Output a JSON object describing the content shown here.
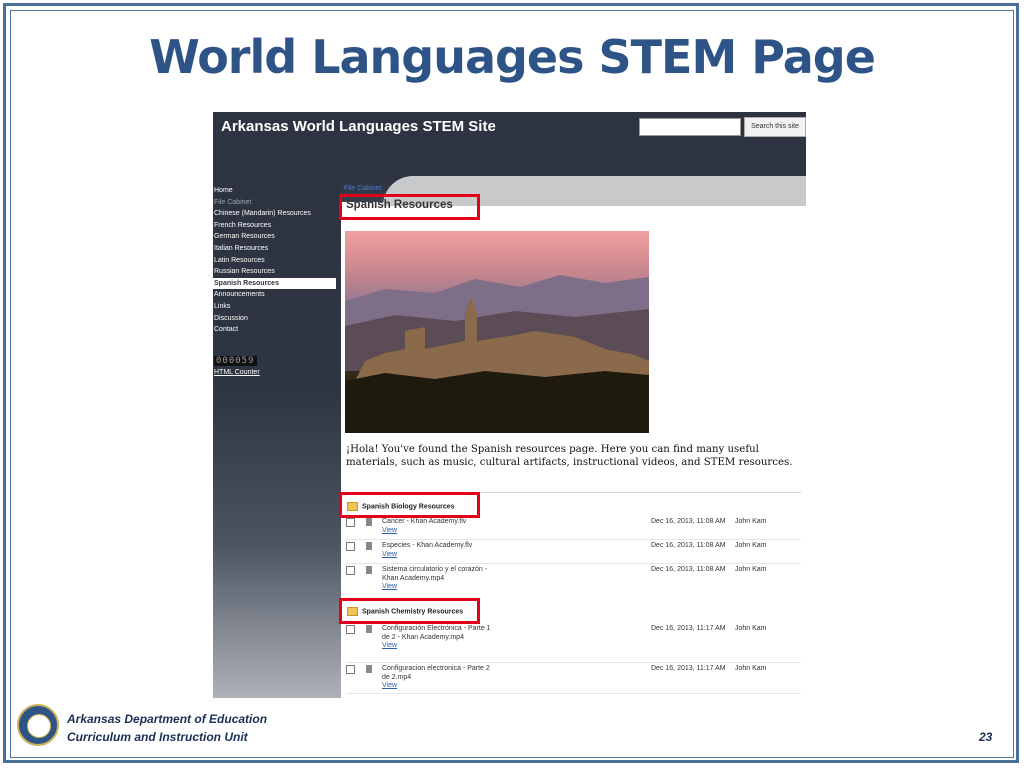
{
  "slide": {
    "title": "World Languages STEM Page",
    "footer_line1": "Arkansas Department of Education",
    "footer_line2": "Curriculum and Instruction Unit",
    "page_number": "23"
  },
  "site": {
    "title": "Arkansas World Languages STEM Site",
    "search_placeholder": "",
    "search_button": "Search this site"
  },
  "sidebar": {
    "items": [
      {
        "label": "Home"
      },
      {
        "label": "File Cabinet"
      },
      {
        "label": "Chinese (Mandarin) Resources"
      },
      {
        "label": "French Resources"
      },
      {
        "label": "German Resources"
      },
      {
        "label": "Italian Resources"
      },
      {
        "label": "Latin Resources"
      },
      {
        "label": "Russian Resources"
      },
      {
        "label": "Spanish Resources"
      },
      {
        "label": "Announcements"
      },
      {
        "label": "Links"
      },
      {
        "label": "Discussion"
      },
      {
        "label": "Contact"
      }
    ],
    "active_item": "Spanish Resources",
    "counter_value": "000059",
    "counter_link": "HTML Counter"
  },
  "main": {
    "breadcrumb": "File Cabinet",
    "heading": "Spanish Resources",
    "intro": "¡Hola!  You've found the Spanish resources page.  Here you can find many useful materials, such as music, cultural artifacts, instructional videos, and STEM resources.",
    "folders": [
      {
        "name": "Spanish Biology Resources",
        "files": [
          {
            "name": "Cancer - Khan Academy.flv",
            "view": "View",
            "date": "Dec 16, 2013, 11:08 AM",
            "author": "John Kam"
          },
          {
            "name": "Especies - Khan Academy.flv",
            "view": "View",
            "date": "Dec 16, 2013, 11:08 AM",
            "author": "John Kam"
          },
          {
            "name": "Sistema circulatorio y el corazón - Khan Academy.mp4",
            "view": "View",
            "date": "Dec 16, 2013, 11:08 AM",
            "author": "John Kam"
          }
        ]
      },
      {
        "name": "Spanish Chemistry Resources",
        "files": [
          {
            "name": "Configuración Electrónica - Parte 1 de 2 - Khan Academy.mp4",
            "view": "View",
            "date": "Dec 16, 2013, 11:17 AM",
            "author": "John Kam"
          },
          {
            "name": "Configuracion electronica - Parte 2 de 2.mp4",
            "view": "View",
            "date": "Dec 16, 2013, 11:17 AM",
            "author": "John Kam"
          }
        ]
      }
    ]
  },
  "colors": {
    "title": "#2e5487",
    "highlight": "#e3001b",
    "header_bg": "#2d3340"
  }
}
